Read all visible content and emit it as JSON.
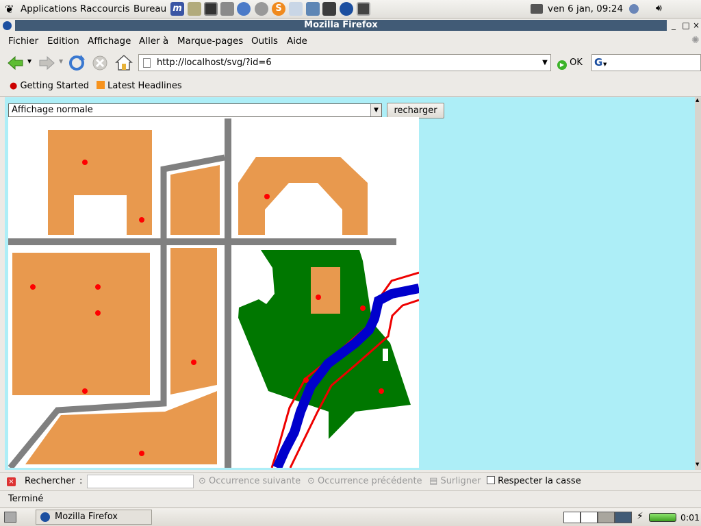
{
  "panel": {
    "menus": [
      "Applications",
      "Raccourcis",
      "Bureau"
    ],
    "clock": "ven  6 jan, 09:24"
  },
  "window": {
    "title": "Mozilla Firefox"
  },
  "menubar": [
    "Fichier",
    "Edition",
    "Affichage",
    "Aller à",
    "Marque-pages",
    "Outils",
    "Aide"
  ],
  "navbar": {
    "url": "http://localhost/svg/?id=6",
    "go_label": "OK"
  },
  "bookmarks": [
    "Getting Started",
    "Latest Headlines"
  ],
  "page": {
    "select_value": "Affichage normale",
    "reload_label": "recharger"
  },
  "findbar": {
    "label": "Rechercher",
    "colon": ":",
    "next": "Occurrence suivante",
    "previous": "Occurrence précédente",
    "highlight": "Surligner",
    "match_case": "Respecter la casse"
  },
  "status": {
    "text": "Terminé"
  },
  "taskbar": {
    "task": "Mozilla Firefox",
    "battery_time": "0:01"
  },
  "colors": {
    "building": "#e8994e",
    "road": "#808080",
    "forest": "#007700",
    "river": "#0000cc",
    "river_bank": "#ee0000",
    "point": "#ff0000",
    "page_background": "#adeef7",
    "title_bar": "#415b76"
  }
}
